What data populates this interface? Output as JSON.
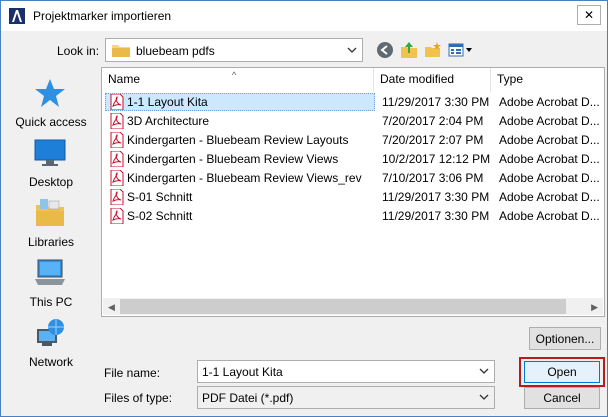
{
  "window": {
    "title": "Projektmarker importieren",
    "close_glyph": "✕"
  },
  "toolbar": {
    "look_in_label": "Look in:",
    "look_in_value": "bluebeam pdfs",
    "icons": [
      "back-icon",
      "up-folder-icon",
      "new-folder-icon",
      "view-menu-icon"
    ]
  },
  "places": [
    {
      "label": "Quick access",
      "icon": "quick-access-star-icon"
    },
    {
      "label": "Desktop",
      "icon": "desktop-icon"
    },
    {
      "label": "Libraries",
      "icon": "libraries-icon"
    },
    {
      "label": "This PC",
      "icon": "this-pc-icon"
    },
    {
      "label": "Network",
      "icon": "network-icon"
    }
  ],
  "columns": {
    "name": "Name",
    "date": "Date modified",
    "type": "Type"
  },
  "files": [
    {
      "name": "1-1 Layout Kita",
      "date": "11/29/2017 3:30 PM",
      "type": "Adobe Acrobat D...",
      "selected": true
    },
    {
      "name": "3D Architecture",
      "date": "7/20/2017 2:04 PM",
      "type": "Adobe Acrobat D..."
    },
    {
      "name": "Kindergarten - Bluebeam Review Layouts",
      "date": "7/20/2017 2:07 PM",
      "type": "Adobe Acrobat D..."
    },
    {
      "name": "Kindergarten - Bluebeam Review Views",
      "date": "10/2/2017 12:12 PM",
      "type": "Adobe Acrobat D..."
    },
    {
      "name": "Kindergarten - Bluebeam Review Views_rev",
      "date": "7/10/2017 3:06 PM",
      "type": "Adobe Acrobat D..."
    },
    {
      "name": "S-01 Schnitt",
      "date": "11/29/2017 3:30 PM",
      "type": "Adobe Acrobat D..."
    },
    {
      "name": "S-02 Schnitt",
      "date": "11/29/2017 3:30 PM",
      "type": "Adobe Acrobat D..."
    }
  ],
  "options_button": "Optionen...",
  "file_name": {
    "label": "File name:",
    "value": "1-1 Layout Kita"
  },
  "file_type": {
    "label": "Files of type:",
    "value": "PDF Datei (*.pdf)"
  },
  "buttons": {
    "open": "Open",
    "cancel": "Cancel"
  },
  "colors": {
    "selection": "#cce8ff",
    "focus_highlight": "#b51c1c",
    "pdf_red": "#c8102e"
  }
}
